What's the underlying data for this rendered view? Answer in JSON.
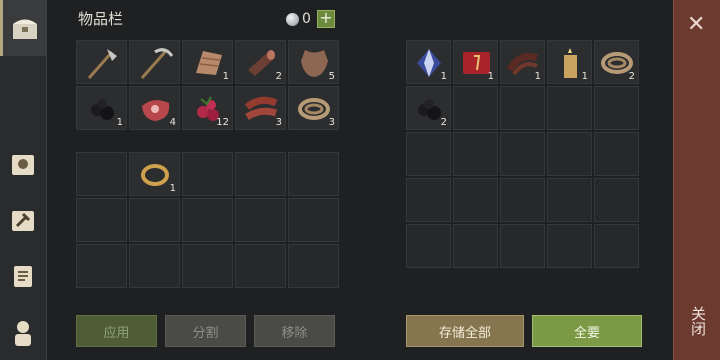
{
  "header": {
    "title": "物品栏",
    "currency_value": "0",
    "plus_label": "+"
  },
  "sidebar": {
    "tabs": [
      "inventory-chest-icon",
      "daily-sun-icon",
      "crafting-hammer-icon",
      "quest-scroll-icon",
      "character-icon"
    ]
  },
  "inventory": {
    "row1": [
      {
        "name": "hatchet-icon",
        "count": ""
      },
      {
        "name": "pickaxe-icon",
        "count": ""
      },
      {
        "name": "plant-fiber-icon",
        "count": "1"
      },
      {
        "name": "log-icon",
        "count": "2"
      },
      {
        "name": "leather-hide-icon",
        "count": "5"
      }
    ],
    "row2": [
      {
        "name": "coal-icon",
        "count": "1"
      },
      {
        "name": "raw-meat-icon",
        "count": "4"
      },
      {
        "name": "berries-icon",
        "count": "12"
      },
      {
        "name": "bacon-icon",
        "count": "3"
      },
      {
        "name": "rope-icon",
        "count": "3"
      }
    ],
    "equip_ring_count": "1"
  },
  "storage": {
    "row1": [
      {
        "name": "crystal-icon",
        "count": "1"
      },
      {
        "name": "book-icon",
        "count": "1"
      },
      {
        "name": "leather-strap-icon",
        "count": "1"
      },
      {
        "name": "candle-icon",
        "count": "1"
      },
      {
        "name": "rope-icon",
        "count": "2"
      }
    ],
    "row2": [
      {
        "name": "coal-icon",
        "count": "2"
      }
    ]
  },
  "buttons": {
    "apply": "应用",
    "split": "分割",
    "remove": "移除",
    "store_all": "存储全部",
    "take_all": "全要"
  },
  "close": {
    "label": "关闭"
  }
}
